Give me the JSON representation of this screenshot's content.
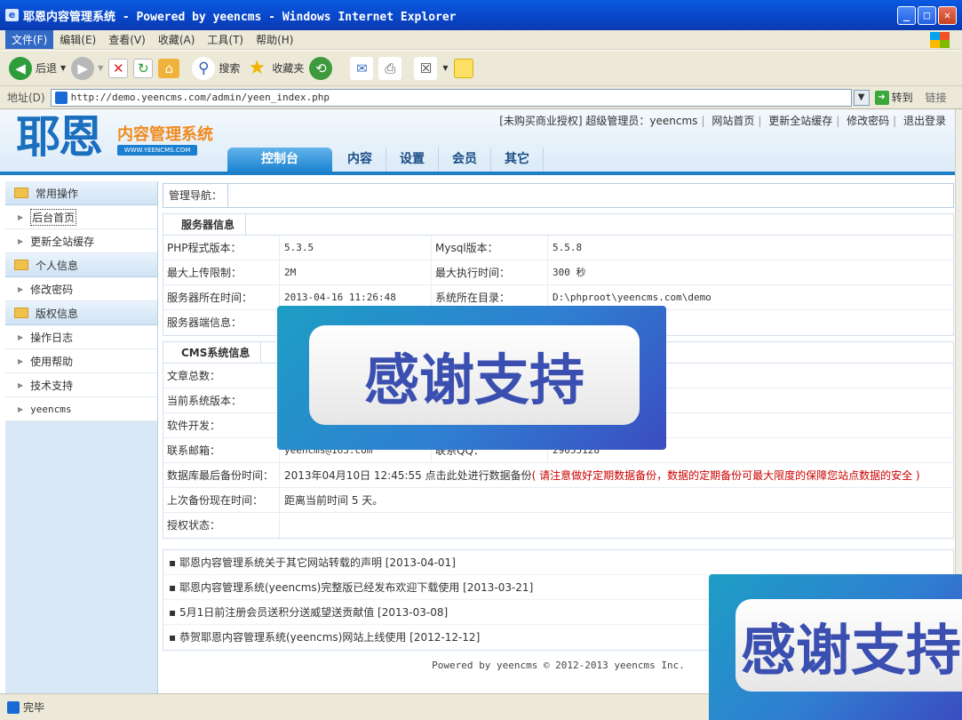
{
  "window": {
    "title": "耶恩内容管理系统 - Powered by yeencms - Windows Internet Explorer"
  },
  "menu": [
    "文件(F)",
    "编辑(E)",
    "查看(V)",
    "收藏(A)",
    "工具(T)",
    "帮助(H)"
  ],
  "toolbar": {
    "back": "后退",
    "search": "搜索",
    "favorites": "收藏夹"
  },
  "address": {
    "label": "地址(D)",
    "url": "http://demo.yeencms.com/admin/yeen_index.php",
    "go": "转到",
    "links": "链接"
  },
  "header": {
    "logo": "耶恩",
    "logo_sub": "内容管理系统",
    "logo_url": "WWW.YEENCMS.COM",
    "top_links": [
      "[未购买商业授权] 超级管理员：yeencms",
      "网站首页",
      "更新全站缓存",
      "修改密码",
      "退出登录"
    ],
    "tabs": [
      "控制台",
      "内容",
      "设置",
      "会员",
      "其它"
    ]
  },
  "sidebar": {
    "groups": [
      {
        "title": "常用操作",
        "items": [
          "后台首页",
          "更新全站缓存"
        ]
      },
      {
        "title": "个人信息",
        "items": [
          "修改密码"
        ]
      },
      {
        "title": "版权信息",
        "items": [
          "操作日志",
          "使用帮助",
          "技术支持",
          "yeencms"
        ]
      }
    ]
  },
  "main": {
    "nav_label": "管理导航：",
    "server": {
      "title": "服务器信息",
      "rows": [
        [
          "PHP程式版本：",
          "5.3.5",
          "Mysql版本：",
          "5.5.8"
        ],
        [
          "最大上传限制：",
          "2M",
          "最大执行时间：",
          "300 秒"
        ],
        [
          "服务器所在时间：",
          "2013-04-16 11:26:48",
          "系统所在目录：",
          "D:\\phproot\\yeencms.com\\demo"
        ],
        [
          "服务器端信息：",
          "",
          "",
          ""
        ]
      ]
    },
    "cms": {
      "title": "CMS系统信息",
      "rows": [
        [
          "文章总数：",
          "",
          "",
          ""
        ],
        [
          "当前系统版本：",
          "",
          "",
          ""
        ],
        [
          "软件开发：",
          "",
          "",
          ""
        ],
        [
          "联系邮箱：",
          "yeencms@163.com",
          "联系QQ：",
          "29055128"
        ]
      ],
      "backup_label": "数据库最后备份时间：",
      "backup_value": "2013年04月10日 12:45:55 点击此处进行数据备份",
      "backup_warning": "( 请注意做好定期数据备份，数据的定期备份可最大限度的保障您站点数据的安全 )",
      "since_label": "上次备份现在时间：",
      "since_value": "距离当前时间 5 天。",
      "auth_label": "授权状态：",
      "auth_value": ""
    },
    "news": [
      "耶恩内容管理系统关于其它网站转载的声明 [2013-04-01]",
      "耶恩内容管理系统(yeencms)完整版已经发布欢迎下载使用 [2013-03-21]",
      "5月1日前注册会员送积分送威望送贡献值 [2013-03-08]",
      "恭贺耶恩内容管理系统(yeencms)网站上线使用 [2012-12-12]"
    ],
    "footer": "Powered by yeencms © 2012-2013 yeencms Inc."
  },
  "status": {
    "text": "完毕"
  },
  "overlay": {
    "text": "感谢支持"
  }
}
